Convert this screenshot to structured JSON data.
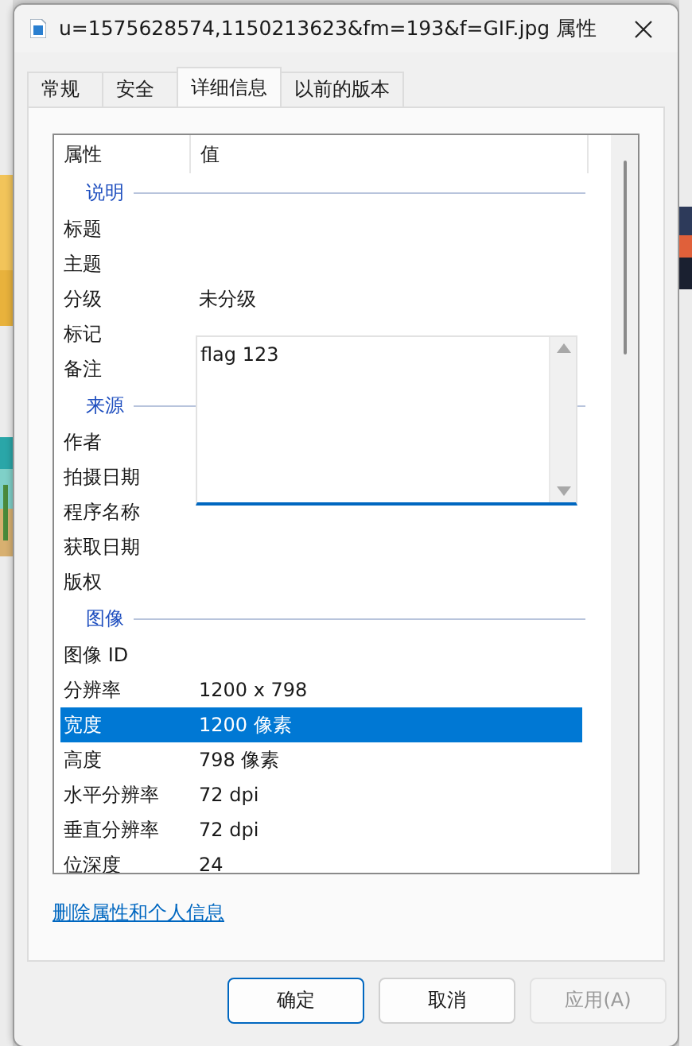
{
  "window": {
    "title": "u=1575628574,1150213623&fm=193&f=GIF.jpg 属性"
  },
  "tabs": [
    {
      "label": "常规",
      "selected": false
    },
    {
      "label": "安全",
      "selected": false
    },
    {
      "label": "详细信息",
      "selected": true
    },
    {
      "label": "以前的版本",
      "selected": false
    }
  ],
  "property_list": {
    "columns": [
      "属性",
      "值"
    ],
    "groups": [
      {
        "title": "说明",
        "rows": [
          {
            "name": "标题",
            "selected": false,
            "editing": false
          },
          {
            "name": "主题",
            "selected": false,
            "editing": false
          },
          {
            "name": "分级",
            "value": "未分级",
            "selected": false,
            "editing": false
          },
          {
            "name": "标记",
            "selected": false,
            "editing": false
          },
          {
            "name": "备注",
            "value": "flag 123",
            "selected": false,
            "editing": true
          }
        ]
      },
      {
        "title": "来源",
        "rows": [
          {
            "name": "作者",
            "selected": false,
            "editing": false
          },
          {
            "name": "拍摄日期",
            "selected": false,
            "editing": false
          },
          {
            "name": "程序名称",
            "selected": false,
            "editing": false
          },
          {
            "name": "获取日期",
            "selected": false,
            "editing": false
          },
          {
            "name": "版权",
            "selected": false,
            "editing": false
          }
        ]
      },
      {
        "title": "图像",
        "rows": [
          {
            "name": "图像 ID",
            "selected": false,
            "editing": false
          },
          {
            "name": "分辨率",
            "value": "1200 x 798",
            "selected": false,
            "editing": false
          },
          {
            "name": "宽度",
            "value": "1200 像素",
            "selected": true,
            "editing": false
          },
          {
            "name": "高度",
            "value": "798 像素",
            "selected": false,
            "editing": false
          },
          {
            "name": "水平分辨率",
            "value": "72 dpi",
            "selected": false,
            "editing": false
          },
          {
            "name": "垂直分辨率",
            "value": "72 dpi",
            "selected": false,
            "editing": false
          },
          {
            "name": "位深度",
            "value": "24",
            "selected": false,
            "editing": false
          }
        ]
      }
    ]
  },
  "link": "删除属性和个人信息",
  "buttons": [
    {
      "label": "确定",
      "default": true,
      "disabled": false
    },
    {
      "label": "取消",
      "default": false,
      "disabled": false
    },
    {
      "label": "应用(A)",
      "default": false,
      "disabled": true
    }
  ]
}
